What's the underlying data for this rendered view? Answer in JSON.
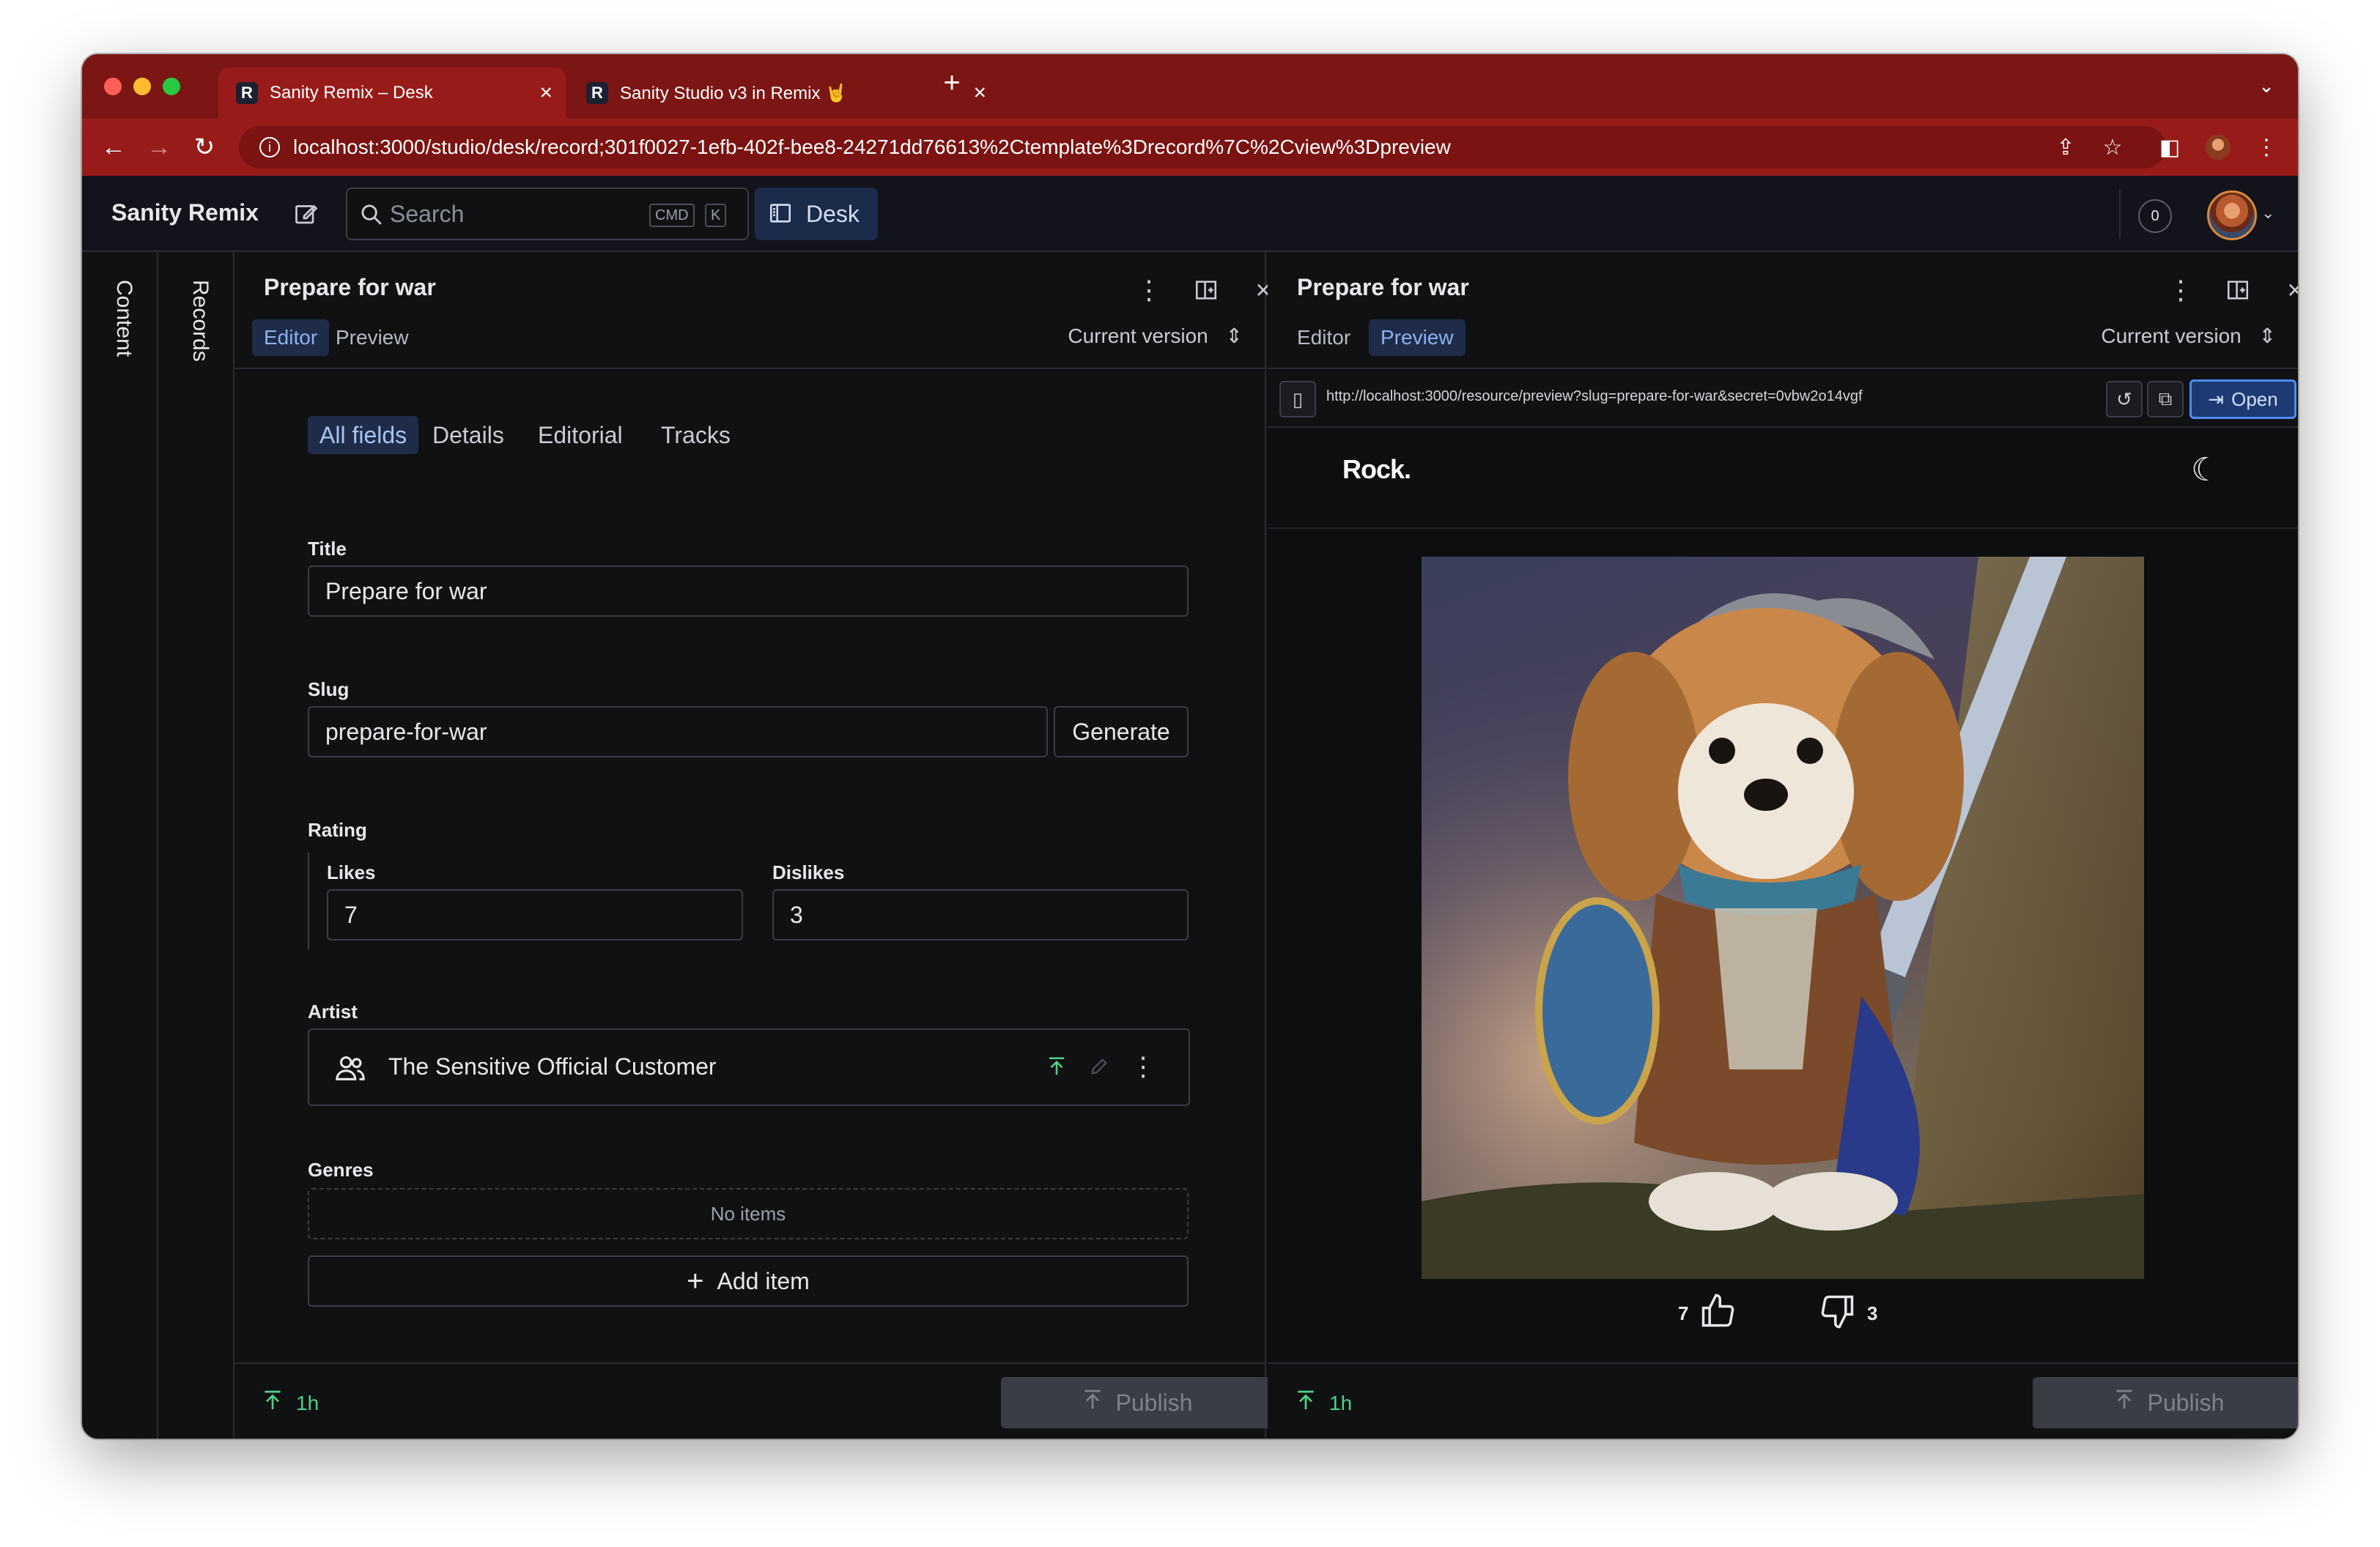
{
  "browser": {
    "tabs": [
      {
        "title": "Sanity Remix – Desk",
        "favicon": "R",
        "active": true
      },
      {
        "title": "Sanity Studio v3 in Remix 🤘",
        "favicon": "R",
        "active": false
      }
    ],
    "url": "localhost:3000/studio/desk/record;301f0027-1efb-402f-bee8-24271dd76613%2Ctemplate%3Drecord%7C%2Cview%3Dpreview"
  },
  "navbar": {
    "brand": "Sanity Remix",
    "search_placeholder": "Search",
    "kbd_cmd": "CMD",
    "kbd_k": "K",
    "desk_label": "Desk",
    "notification_count": "0"
  },
  "rails": {
    "content": "Content",
    "records": "Records"
  },
  "editor_pane": {
    "title": "Prepare for war",
    "tabs": [
      "Editor",
      "Preview"
    ],
    "active_tab": "Editor",
    "version": "Current version",
    "field_tabs": [
      "All fields",
      "Details",
      "Editorial",
      "Tracks"
    ],
    "fields": {
      "title_label": "Title",
      "title_value": "Prepare for war",
      "slug_label": "Slug",
      "slug_value": "prepare-for-war",
      "generate_label": "Generate",
      "rating_label": "Rating",
      "likes_label": "Likes",
      "likes_value": "7",
      "dislikes_label": "Dislikes",
      "dislikes_value": "3",
      "artist_label": "Artist",
      "artist_value": "The Sensitive Official Customer",
      "genres_label": "Genres",
      "genres_empty": "No items",
      "add_item_label": "Add item"
    },
    "footer": {
      "status_time": "1h",
      "publish_label": "Publish"
    }
  },
  "preview_pane": {
    "title": "Prepare for war",
    "tabs": [
      "Editor",
      "Preview"
    ],
    "active_tab": "Preview",
    "version": "Current version",
    "preview_url": "http://localhost:3000/resource/preview?slug=prepare-for-war&secret=0vbw2o14vgf",
    "open_label": "Open",
    "site_logo": "Rock.",
    "likes": "7",
    "dislikes": "3",
    "footer": {
      "status_time": "1h",
      "publish_label": "Publish"
    }
  },
  "colors": {
    "chrome": "#7c1614",
    "accent": "#4f8cf4",
    "status_green": "#4fd18a"
  }
}
